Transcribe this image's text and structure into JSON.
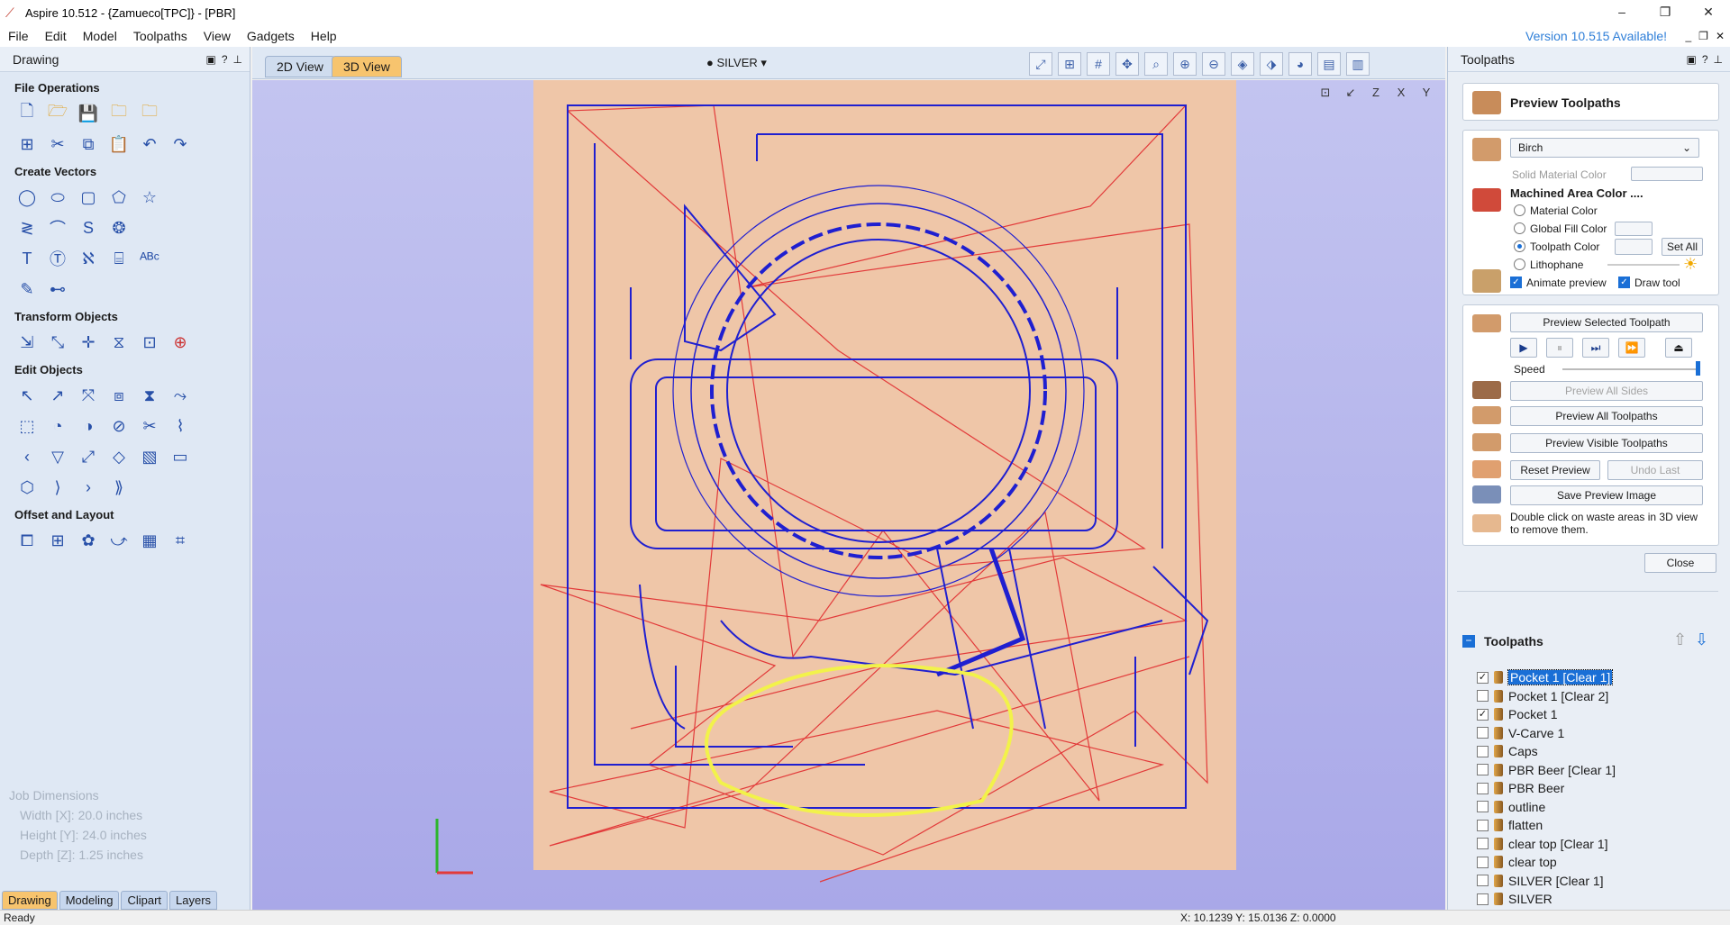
{
  "window": {
    "title": "Aspire 10.512 - {Zamueco[TPC]} - [PBR]",
    "min": "–",
    "max": "❐",
    "close": "✕"
  },
  "menu": {
    "items": [
      "File",
      "Edit",
      "Model",
      "Toolpaths",
      "View",
      "Gadgets",
      "Help"
    ],
    "version_notice": "Version 10.515 Available!",
    "mdi": [
      "_",
      "❐",
      "✕"
    ]
  },
  "left_panel": {
    "title": "Drawing",
    "sections": {
      "file_ops": "File Operations",
      "create_vectors": "Create Vectors",
      "transform": "Transform Objects",
      "edit": "Edit Objects",
      "offset": "Offset and Layout"
    },
    "job": {
      "heading": "Job Dimensions",
      "width": "Width  [X]: 20.0 inches",
      "height": "Height [Y]: 24.0 inches",
      "depth": "Depth  [Z]: 1.25 inches"
    },
    "tabs": [
      "Drawing",
      "Modeling",
      "Clipart",
      "Layers"
    ]
  },
  "view": {
    "tab_2d": "2D View",
    "tab_3d": "3D View",
    "material_selector": "SILVER ▾",
    "orient": [
      "⊡",
      "↙",
      "Z",
      "X",
      "Y"
    ]
  },
  "right_panel": {
    "title": "Toolpaths",
    "preview_title": "Preview Toolpaths",
    "material": "Birch",
    "solid_material_color": "Solid Material Color",
    "machined_area": "Machined Area Color ....",
    "radio": [
      "Material Color",
      "Global Fill Color",
      "Toolpath Color",
      "Lithophane"
    ],
    "set_all": "Set All",
    "animate_preview": "Animate preview",
    "draw_tool": "Draw tool",
    "preview_selected": "Preview Selected Toolpath",
    "speed": "Speed",
    "preview_all_sides": "Preview All Sides",
    "preview_all": "Preview All Toolpaths",
    "preview_visible": "Preview Visible Toolpaths",
    "reset_preview": "Reset Preview",
    "undo_last": "Undo Last",
    "save_image": "Save Preview Image",
    "hint": "Double click on waste areas in 3D view to remove them.",
    "close": "Close",
    "list_title": "Toolpaths",
    "toolpaths": [
      {
        "label": "Pocket 1 [Clear 1]",
        "checked": true,
        "selected": true
      },
      {
        "label": "Pocket 1 [Clear 2]",
        "checked": false,
        "selected": false
      },
      {
        "label": "Pocket 1",
        "checked": true,
        "selected": false
      },
      {
        "label": "V-Carve 1",
        "checked": false,
        "selected": false
      },
      {
        "label": "Caps",
        "checked": false,
        "selected": false
      },
      {
        "label": "PBR Beer [Clear 1]",
        "checked": false,
        "selected": false
      },
      {
        "label": "PBR Beer",
        "checked": false,
        "selected": false
      },
      {
        "label": "outline",
        "checked": false,
        "selected": false
      },
      {
        "label": "flatten",
        "checked": false,
        "selected": false
      },
      {
        "label": "clear top [Clear 1]",
        "checked": false,
        "selected": false
      },
      {
        "label": "clear top",
        "checked": false,
        "selected": false
      },
      {
        "label": "SILVER [Clear 1]",
        "checked": false,
        "selected": false
      },
      {
        "label": "SILVER",
        "checked": false,
        "selected": false
      }
    ]
  },
  "status": {
    "left": "Ready",
    "coords": "X: 10.1239 Y: 15.0136 Z: 0.0000"
  },
  "colors": {
    "accent": "#1a6fd6",
    "tab_active": "#f7c46e",
    "board": "#efc6a8",
    "toolpath_blue": "#1f1fd0",
    "rapid_red": "#e23a3a",
    "highlight_yellow": "#f2f24a"
  }
}
